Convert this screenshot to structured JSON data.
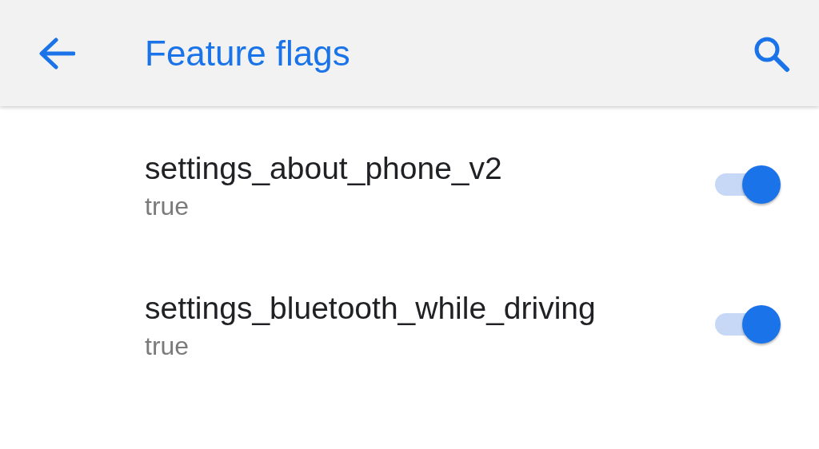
{
  "app_bar": {
    "title": "Feature flags"
  },
  "flags": [
    {
      "name": "settings_about_phone_v2",
      "value": "true",
      "on": true
    },
    {
      "name": "settings_bluetooth_while_driving",
      "value": "true",
      "on": true
    }
  ]
}
